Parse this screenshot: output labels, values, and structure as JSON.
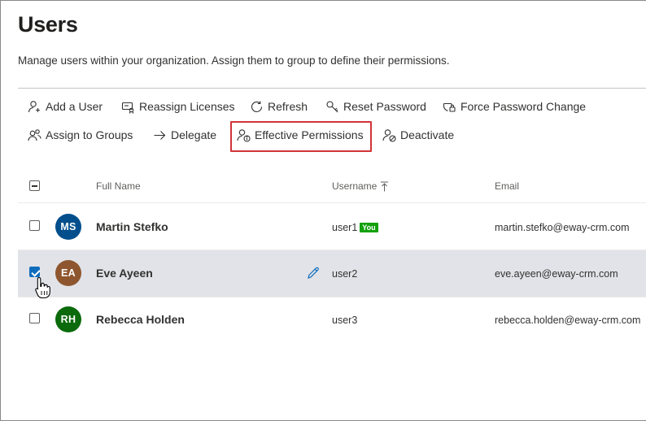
{
  "page": {
    "title": "Users",
    "subtitle": "Manage users within your organization. Assign them to group to define their permissions."
  },
  "toolbar": {
    "add_user": "Add a User",
    "reassign_licenses": "Reassign Licenses",
    "refresh": "Refresh",
    "reset_password": "Reset Password",
    "force_password_change": "Force Password Change",
    "assign_to_groups": "Assign to Groups",
    "delegate": "Delegate",
    "effective_permissions": "Effective Permissions",
    "deactivate": "Deactivate"
  },
  "table": {
    "columns": {
      "full_name": "Full Name",
      "username": "Username",
      "email": "Email"
    },
    "you_badge": "You",
    "rows": [
      {
        "initials": "MS",
        "avatar_color": "#004e8c",
        "name": "Martin Stefko",
        "username": "user1",
        "email": "martin.stefko@eway-crm.com",
        "checked": false,
        "is_you": true
      },
      {
        "initials": "EA",
        "avatar_color": "#8e562e",
        "name": "Eve Ayeen",
        "username": "user2",
        "email": "eve.ayeen@eway-crm.com",
        "checked": true,
        "is_you": false
      },
      {
        "initials": "RH",
        "avatar_color": "#0b6a0b",
        "name": "Rebecca Holden",
        "username": "user3",
        "email": "rebecca.holden@eway-crm.com",
        "checked": false,
        "is_you": false
      }
    ]
  },
  "colors": {
    "accent": "#0f6cbd",
    "highlight_border": "#d13438",
    "selected_row": "#e1e3e8",
    "badge": "#13a10e"
  }
}
